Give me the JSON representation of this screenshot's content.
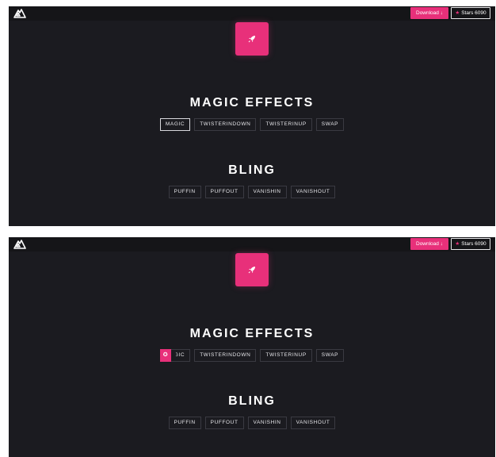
{
  "frames": [
    {
      "header": {
        "download_label": "Download",
        "download_icon": "↓",
        "stars_icon": "★",
        "stars_label": "Stars 6090"
      },
      "sections": [
        {
          "title": "MAGIC EFFECTS",
          "buttons": [
            "MAGIC",
            "TWISTERINDOWN",
            "TWISTERINUP",
            "SWAP"
          ]
        },
        {
          "title": "BLING",
          "buttons": [
            "PUFFIN",
            "PUFFOUT",
            "VANISHIN",
            "VANISHOUT"
          ]
        }
      ],
      "focused_button": "MAGIC"
    },
    {
      "header": {
        "download_label": "Download",
        "download_icon": "↓",
        "stars_icon": "★",
        "stars_label": "Stars 6090"
      },
      "sections": [
        {
          "title": "MAGIC EFFECTS",
          "buttons": [
            "MAGIC",
            "TWISTERINDOWN",
            "TWISTERINUP",
            "SWAP"
          ]
        },
        {
          "title": "BLING",
          "buttons": [
            "PUFFIN",
            "PUFFOUT",
            "VANISHIN",
            "VANISHOUT"
          ]
        }
      ],
      "animating_button": "MAGIC",
      "magic_overlay_glyph": "✪"
    }
  ],
  "colors": {
    "accent": "#e8307a",
    "background": "#1b1b20",
    "topbar": "#151518",
    "button_border": "#3a3a42"
  },
  "icons": {
    "logo": "mountain-logo-icon",
    "tile": "rocket-icon"
  }
}
